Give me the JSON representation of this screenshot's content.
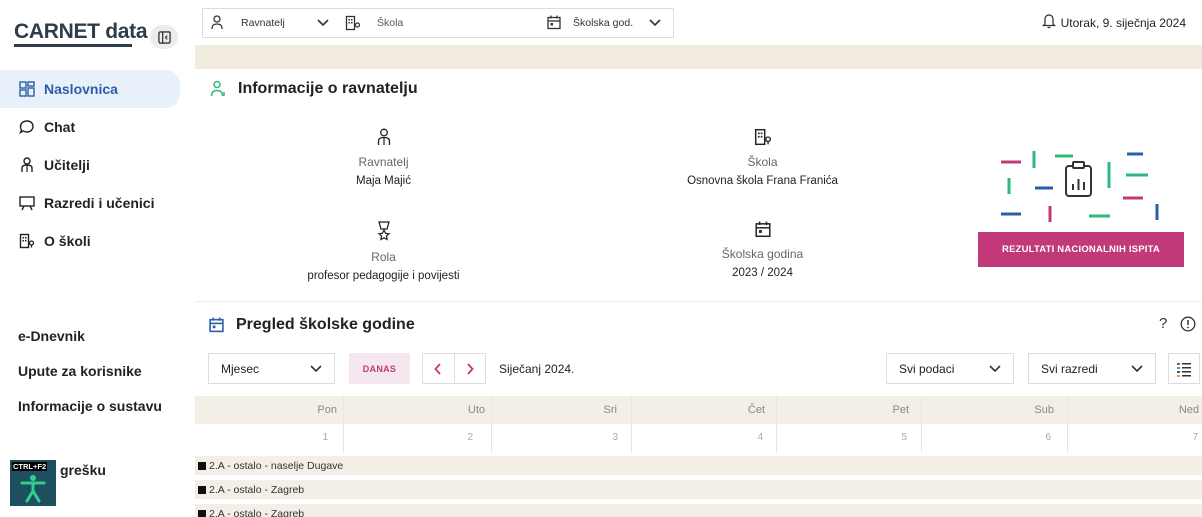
{
  "sidebar": {
    "logo": "CARNET data",
    "nav": [
      {
        "label": "Naslovnica"
      },
      {
        "label": "Chat"
      },
      {
        "label": "Učitelji"
      },
      {
        "label": "Razredi i učenici"
      },
      {
        "label": "O školi"
      }
    ],
    "bottom": [
      "e-Dnevnik",
      "Upute za korisnike",
      "Informacije o sustavu"
    ],
    "a11y_badge": "CTRL+F2",
    "report_error": "grešku"
  },
  "topbar": {
    "role_label": "Ravnatelj",
    "school_placeholder": "Škola",
    "year_label": "Školska god.",
    "date": "Utorak, 9. siječnja 2024"
  },
  "info": {
    "title": "Informacije o ravnatelju",
    "ravnatelj_label": "Ravnatelj",
    "ravnatelj_value": "Maja Majić",
    "skola_label": "Škola",
    "skola_value": "Osnovna škola Frana Franića",
    "rola_label": "Rola",
    "rola_value": "profesor pedagogije i povijesti",
    "godina_label": "Školska godina",
    "godina_value": "2023 / 2024",
    "results_button": "REZULTATI NACIONALNIH ISPITA"
  },
  "calendar": {
    "title": "Pregled školske godine",
    "view_select": "Mjesec",
    "today_button": "DANAS",
    "current_month": "Siječanj 2024.",
    "data_filter": "Svi podaci",
    "class_filter": "Svi razredi",
    "help": "?",
    "days": [
      "Pon",
      "Uto",
      "Sri",
      "Čet",
      "Pet",
      "Sub",
      "Ned"
    ],
    "dates": [
      "1",
      "2",
      "3",
      "4",
      "5",
      "6",
      "7"
    ],
    "events": [
      "2.A - ostalo - naselje Dugave",
      "2.A - ostalo - Zagreb",
      "2.A - ostalo - Zagreb"
    ]
  },
  "colors": {
    "accent_pink": "#c2397a",
    "nav_active": "#2a5fa5",
    "beige": "#f2ebe0"
  }
}
